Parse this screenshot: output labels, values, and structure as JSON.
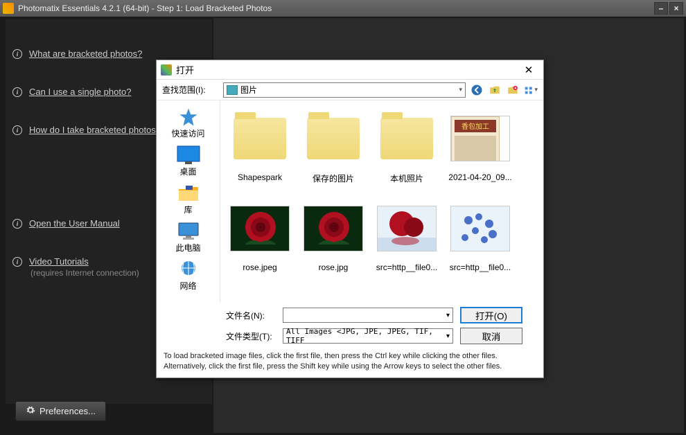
{
  "window": {
    "title": "Photomatix Essentials  4.2.1 (64-bit)  -  Step 1: Load Bracketed Photos"
  },
  "help": {
    "links": [
      "What are bracketed photos?",
      "Can I use a single photo?",
      "How do I take bracketed photos?",
      "Open the User Manual",
      "Video Tutorials"
    ],
    "video_sub": "(requires Internet connection)",
    "preferences_label": "Preferences..."
  },
  "dialog": {
    "title": "打开",
    "lookin_label": "查找范围(I):",
    "location": "图片",
    "places": [
      "快速访问",
      "桌面",
      "库",
      "此电脑",
      "网络"
    ],
    "files": [
      {
        "name": "Shapespark",
        "kind": "folder"
      },
      {
        "name": "保存的图片",
        "kind": "folder"
      },
      {
        "name": "本机照片",
        "kind": "folder"
      },
      {
        "name": "2021-04-20_09...",
        "kind": "image",
        "variant": "poster"
      },
      {
        "name": "rose.jpeg",
        "kind": "image",
        "variant": "rose"
      },
      {
        "name": "rose.jpg",
        "kind": "image",
        "variant": "rose"
      },
      {
        "name": "src=http__file0...",
        "kind": "image",
        "variant": "rose2"
      },
      {
        "name": "src=http__file0...",
        "kind": "image",
        "variant": "blue"
      }
    ],
    "filename_label": "文件名(N):",
    "filename_value": "",
    "filetype_label": "文件类型(T):",
    "filetype_value": "All Images <JPG, JPE, JPEG, TIF, TIFF",
    "open_btn": "打开(O)",
    "cancel_btn": "取消",
    "hint1": "To load bracketed image files, click the first file, then press the Ctrl key while clicking the other files.",
    "hint2": "Alternatively, click the first file, press the Shift key while using the Arrow keys to select the other files."
  }
}
